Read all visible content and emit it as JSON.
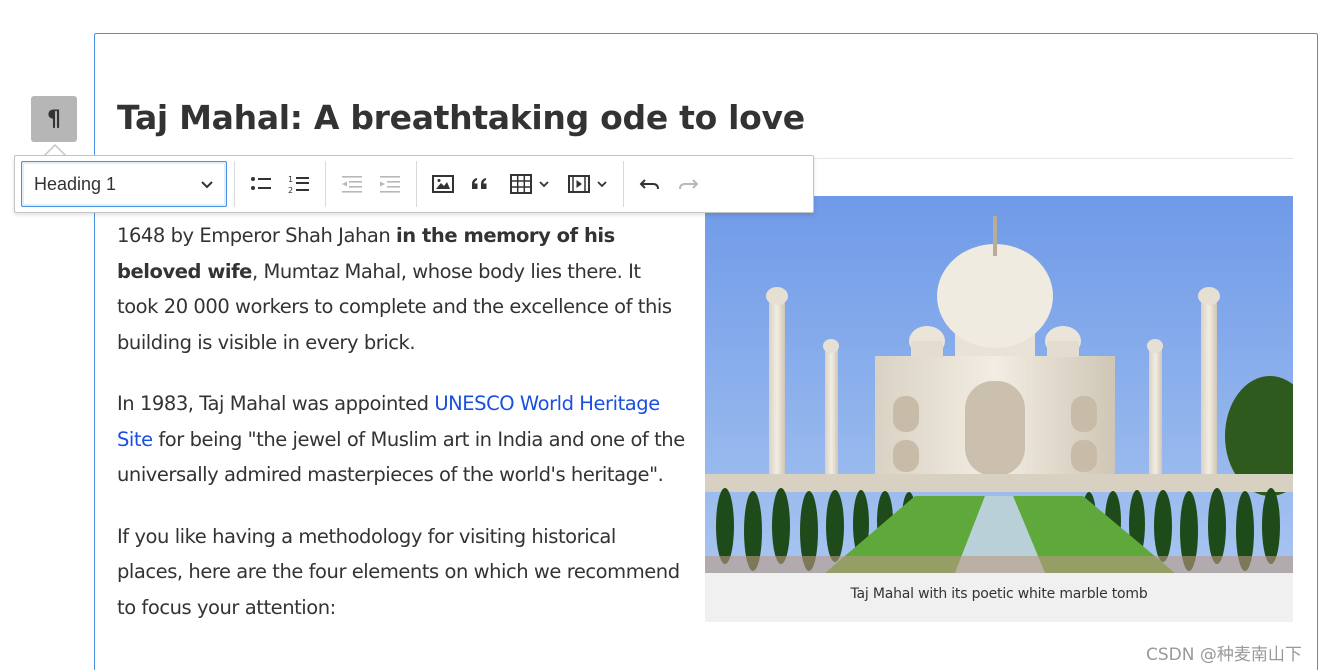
{
  "document": {
    "title": "Taj Mahal: A breathtaking ode to love",
    "paragraph_icon": "¶",
    "p1": {
      "start": "1648 by Emperor Shah Jahan ",
      "bold": "in the memory of his beloved wife",
      "end": ", Mumtaz Mahal, whose body lies there. It took 20 000 workers to complete and the excellence of this building is visible in every brick."
    },
    "p2": {
      "start": "In 1983, Taj Mahal was appointed ",
      "link": "UNESCO World Heritage Site",
      "end": " for being \"the jewel of Muslim art in India and one of the universally admired masterpieces of the world's heritage\"."
    },
    "p3": "If you like having a methodology for visiting historical places, here are the four elements on which we recommend to focus your attention:",
    "image_caption": "Taj Mahal with its poetic white marble tomb"
  },
  "toolbar": {
    "heading_select": "Heading 1",
    "buttons": [
      "bulleted-list-icon",
      "numbered-list-icon",
      "outdent-icon",
      "indent-icon",
      "image-icon",
      "blockquote-icon",
      "table-icon",
      "media-icon",
      "undo-icon",
      "redo-icon"
    ]
  },
  "watermark": "CSDN @种麦南山下",
  "colors": {
    "accent": "#4a90e2",
    "link": "#1a4fe0",
    "paragraph_button": "#b6b6b6"
  }
}
